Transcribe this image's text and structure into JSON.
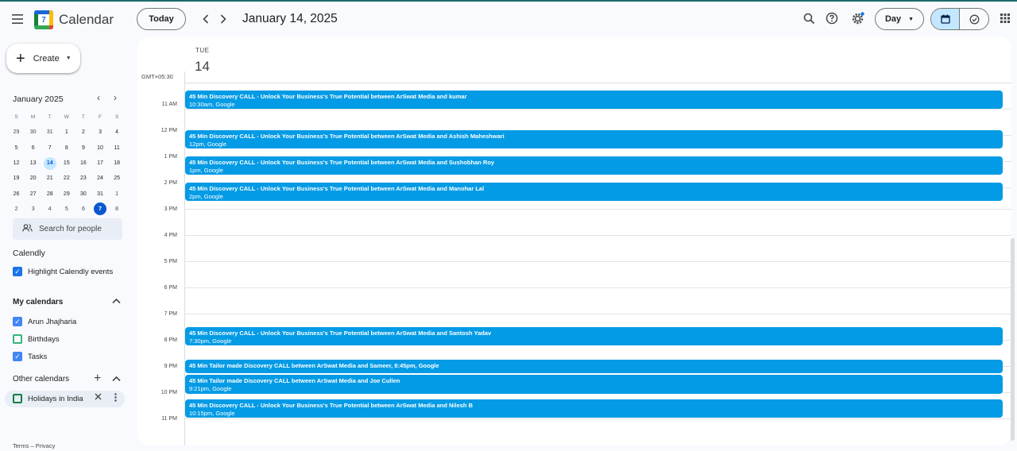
{
  "app": {
    "title": "Calendar",
    "logo_day": "7",
    "today_label": "Today",
    "current_date": "January 14, 2025",
    "view_label": "Day"
  },
  "sidebar": {
    "create_label": "Create",
    "mini_month": "January 2025",
    "dow": [
      "S",
      "M",
      "T",
      "W",
      "T",
      "F",
      "S"
    ],
    "weeks": [
      [
        "29",
        "30",
        "31",
        "1",
        "2",
        "3",
        "4"
      ],
      [
        "5",
        "6",
        "7",
        "8",
        "9",
        "10",
        "11"
      ],
      [
        "12",
        "13",
        "14",
        "15",
        "16",
        "17",
        "18"
      ],
      [
        "19",
        "20",
        "21",
        "22",
        "23",
        "24",
        "25"
      ],
      [
        "26",
        "27",
        "28",
        "29",
        "30",
        "31",
        "1"
      ],
      [
        "2",
        "3",
        "4",
        "5",
        "6",
        "7",
        "8"
      ]
    ],
    "search_people": "Search for people",
    "calendly_title": "Calendly",
    "calendly_highlight": "Highlight Calendly events",
    "my_calendars_title": "My calendars",
    "my_calendars": [
      {
        "label": "Arun Jhajharia",
        "checked": true
      },
      {
        "label": "Birthdays",
        "checked": false
      },
      {
        "label": "Tasks",
        "checked": true
      }
    ],
    "other_calendars_title": "Other calendars",
    "other_calendars": [
      {
        "label": "Holidays in India",
        "checked": false
      }
    ],
    "footer": "Terms – Privacy"
  },
  "day_view": {
    "dow": "TUE",
    "day_number": "14",
    "timezone": "GMT+05:30",
    "hours": [
      "11 AM",
      "12 PM",
      "1 PM",
      "2 PM",
      "3 PM",
      "4 PM",
      "5 PM",
      "6 PM",
      "7 PM",
      "8 PM",
      "9 PM",
      "10 PM",
      "11 PM"
    ],
    "events": [
      {
        "title": "45 Min Discovery CALL - Unlock Your Business's True Potential between ArSwat Media and kumar",
        "time": "10:30am, Google"
      },
      {
        "title": "45 Min Discovery CALL - Unlock Your Business's True Potential between ArSwat Media and Ashish Maheshwari",
        "time": "12pm, Google"
      },
      {
        "title": "45 Min Discovery CALL - Unlock Your Business's True Potential between ArSwat Media and Sushobhan Roy",
        "time": "1pm, Google"
      },
      {
        "title": "45 Min Discovery CALL - Unlock Your Business's True Potential between ArSwat Media and Manohar Lal",
        "time": "2pm, Google"
      },
      {
        "title": "45 Min Discovery CALL - Unlock Your Business's True Potential between ArSwat Media and Santosh Yadav",
        "time": "7:30pm, Google"
      },
      {
        "title": "45 Min Tailor made Discovery CALL between ArSwat Media and Sameer, 8:45pm, Google",
        "time": ""
      },
      {
        "title": "45 Min Tailor made Discovery CALL between ArSwat Media and Joe Cullen",
        "time": "9:21pm, Google"
      },
      {
        "title": "45 Min Discovery CALL - Unlock Your Business's True Potential between ArSwat Media and Nilesh B",
        "time": "10:15pm, Google"
      }
    ]
  },
  "colors": {
    "event": "#039be5",
    "accent": "#0b57d0",
    "selected_bg": "#c2e7ff"
  },
  "icons": [
    "menu-icon",
    "calendar-logo-icon",
    "chevron-left-icon",
    "chevron-right-icon",
    "search-icon",
    "help-icon",
    "settings-icon",
    "calendar-view-icon",
    "tasks-view-icon",
    "apps-grid-icon",
    "plus-icon",
    "people-icon",
    "check-icon",
    "chevron-up-icon",
    "close-icon",
    "more-vert-icon"
  ]
}
